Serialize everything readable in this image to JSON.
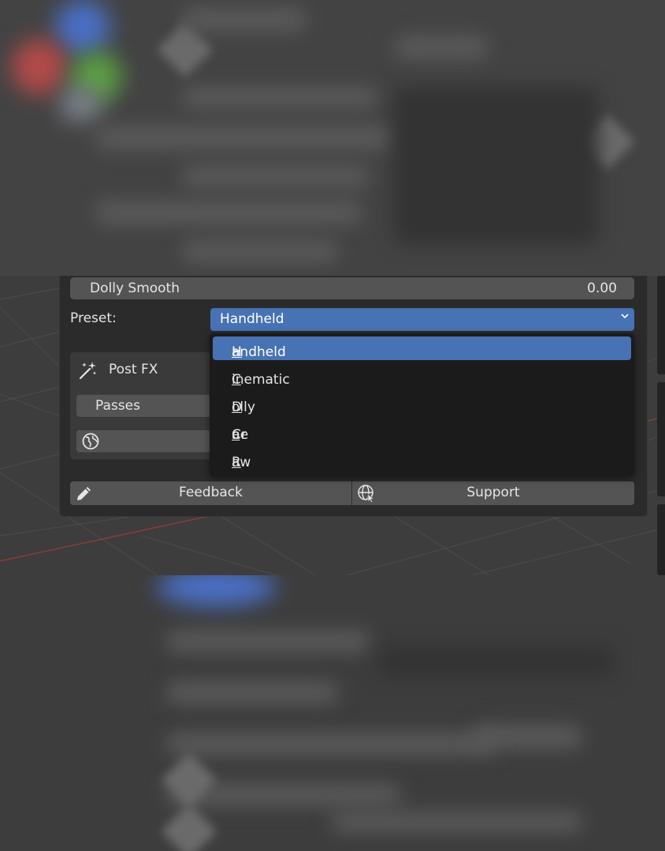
{
  "panel": {
    "dolly_smooth": {
      "label": "Dolly Smooth",
      "value": "0.00"
    },
    "preset": {
      "label": "Preset:",
      "selected": "Handheld"
    },
    "post_fx": {
      "title": "Post FX",
      "passes_label": "Passes"
    },
    "buttons": {
      "feedback": "Feedback",
      "support": "Support"
    }
  },
  "dropdown": {
    "options": [
      {
        "pre": "",
        "key": "H",
        "post": "andheld"
      },
      {
        "pre": "",
        "key": "C",
        "post": "inematic"
      },
      {
        "pre": "",
        "key": "D",
        "post": "olly"
      },
      {
        "pre": "Cr",
        "key": "a",
        "post": "ne"
      },
      {
        "pre": "",
        "key": "R",
        "post": "aw"
      }
    ]
  },
  "colors": {
    "accent": "#4772b3",
    "panel_bg": "#2b2b2b",
    "field_bg": "#545454",
    "menu_bg": "#1b1b1b"
  }
}
